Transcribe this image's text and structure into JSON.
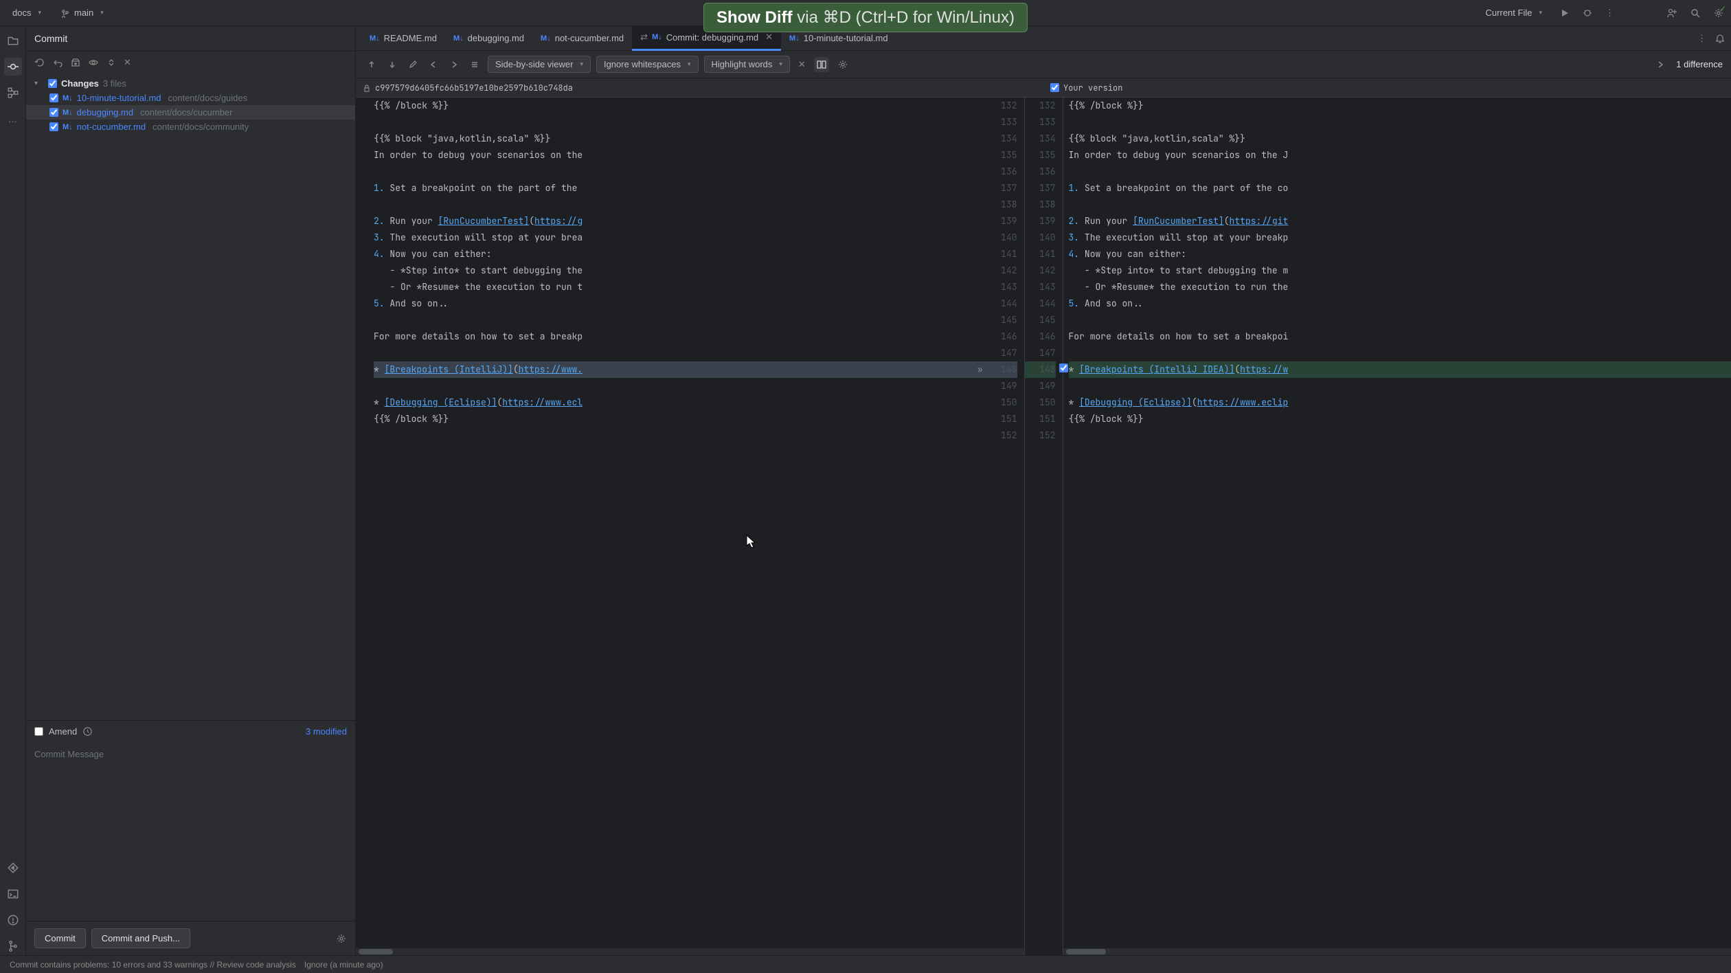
{
  "titlebar": {
    "project": "docs",
    "branch": "main",
    "run_config": "Current File"
  },
  "overlay": {
    "cmd": "Show Diff",
    "rest": " via ⌘D (Ctrl+D for Win/Linux)"
  },
  "commit": {
    "title": "Commit",
    "changes_label": "Changes",
    "changes_count": "3 files",
    "files": [
      {
        "name": "10-minute-tutorial.md",
        "path": "content/docs/guides"
      },
      {
        "name": "debugging.md",
        "path": "content/docs/cucumber"
      },
      {
        "name": "not-cucumber.md",
        "path": "content/docs/community"
      }
    ],
    "amend": "Amend",
    "modified": "3 modified",
    "msg_placeholder": "Commit Message",
    "btn_commit": "Commit",
    "btn_push": "Commit and Push..."
  },
  "tabs": [
    {
      "name": "README.md"
    },
    {
      "name": "debugging.md"
    },
    {
      "name": "not-cucumber.md"
    },
    {
      "name": "Commit: debugging.md",
      "active": true,
      "closable": true
    },
    {
      "name": "10-minute-tutorial.md"
    }
  ],
  "diff_toolbar": {
    "viewer": "Side-by-side viewer",
    "whitespace": "Ignore whitespaces",
    "highlight": "Highlight words",
    "diff_count": "1 difference"
  },
  "diff_headers": {
    "left": "c997579d6405fc66b5197e10be2597b610c748da",
    "right": "Your version"
  },
  "diff_left": {
    "start": 132,
    "lines": [
      "{{% /block %}}",
      "",
      "{{% block \"java,kotlin,scala\" %}}",
      "In order to debug your scenarios on the",
      "",
      "1. Set a breakpoint on the part of the ",
      "",
      "2. Run your [RunCucumberTest](https://g",
      "3. The execution will stop at your brea",
      "4. Now you can either:",
      "   - *Step into* to start debugging the",
      "   - Or *Resume* the execution to run t",
      "5. And so on..",
      "",
      "For more details on how to set a breakp",
      "",
      "* [Breakpoints (IntelliJ)](https://www.",
      "",
      "* [Debugging (Eclipse)](https://www.ecl",
      "{{% /block %}}",
      ""
    ]
  },
  "diff_right": {
    "start": 132,
    "lines": [
      "{{% /block %}}",
      "",
      "{{% block \"java,kotlin,scala\" %}}",
      "In order to debug your scenarios on the J",
      "",
      "1. Set a breakpoint on the part of the co",
      "",
      "2. Run your [RunCucumberTest](https://git",
      "3. The execution will stop at your breakp",
      "4. Now you can either:",
      "   - *Step into* to start debugging the m",
      "   - Or *Resume* the execution to run the",
      "5. And so on..",
      "",
      "For more details on how to set a breakpoi",
      "",
      "* [Breakpoints (IntelliJ IDEA)](https://w",
      "",
      "* [Debugging (Eclipse)](https://www.eclip",
      "{{% /block %}}",
      ""
    ]
  },
  "changed_line_idx": 16,
  "statusbar": {
    "problems": "Commit contains problems: 10 errors and 33 warnings // Review code analysis",
    "ignore": "Ignore (a minute ago)"
  }
}
